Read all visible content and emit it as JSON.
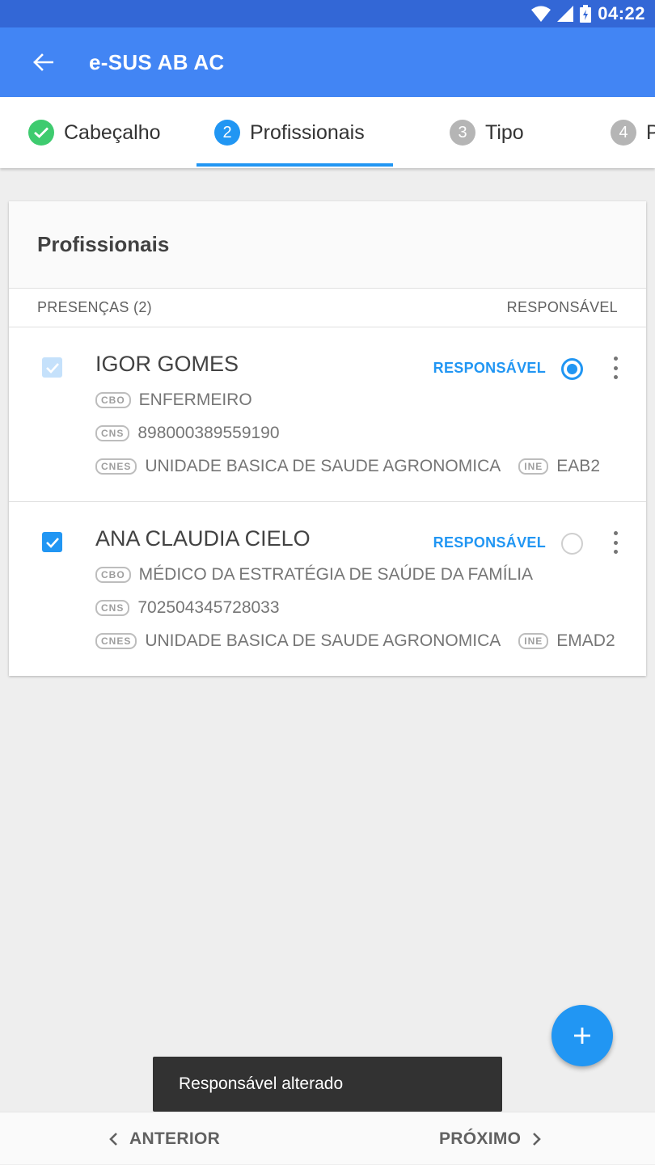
{
  "status_bar": {
    "time": "04:22"
  },
  "app_bar": {
    "title": "e-SUS AB AC"
  },
  "stepper": {
    "steps": [
      {
        "number": "",
        "label": "Cabeçalho"
      },
      {
        "number": "2",
        "label": "Profissionais"
      },
      {
        "number": "3",
        "label": "Tipo"
      },
      {
        "number": "4",
        "label": "P"
      }
    ]
  },
  "card": {
    "title": "Profissionais",
    "presencas_label": "PRESENÇAS (2)",
    "responsavel_header": "RESPONSÁVEL",
    "professionals": [
      {
        "name": "IGOR GOMES",
        "responsavel_label": "RESPONSÁVEL",
        "cbo_tag": "CBO",
        "cbo": "ENFERMEIRO",
        "cns_tag": "CNS",
        "cns": "898000389559190",
        "cnes_tag": "CNES",
        "cnes": "UNIDADE BASICA DE SAUDE AGRONOMICA",
        "ine_tag": "INE",
        "ine": "EAB2"
      },
      {
        "name": "ANA CLAUDIA CIELO",
        "responsavel_label": "RESPONSÁVEL",
        "cbo_tag": "CBO",
        "cbo": "MÉDICO DA ESTRATÉGIA DE SAÚDE DA FAMÍLIA",
        "cns_tag": "CNS",
        "cns": "702504345728033",
        "cnes_tag": "CNES",
        "cnes": "UNIDADE BASICA DE SAUDE AGRONOMICA",
        "ine_tag": "INE",
        "ine": "EMAD2"
      }
    ]
  },
  "snackbar": {
    "message": "Responsável alterado"
  },
  "bottom_bar": {
    "previous_label": "ANTERIOR",
    "next_label": "PRÓXIMO"
  },
  "colors": {
    "status_bar": "#3367d6",
    "app_bar": "#4285f4",
    "accent": "#2196f3",
    "step_done": "#3ecb6f",
    "snackbar": "#323232"
  }
}
